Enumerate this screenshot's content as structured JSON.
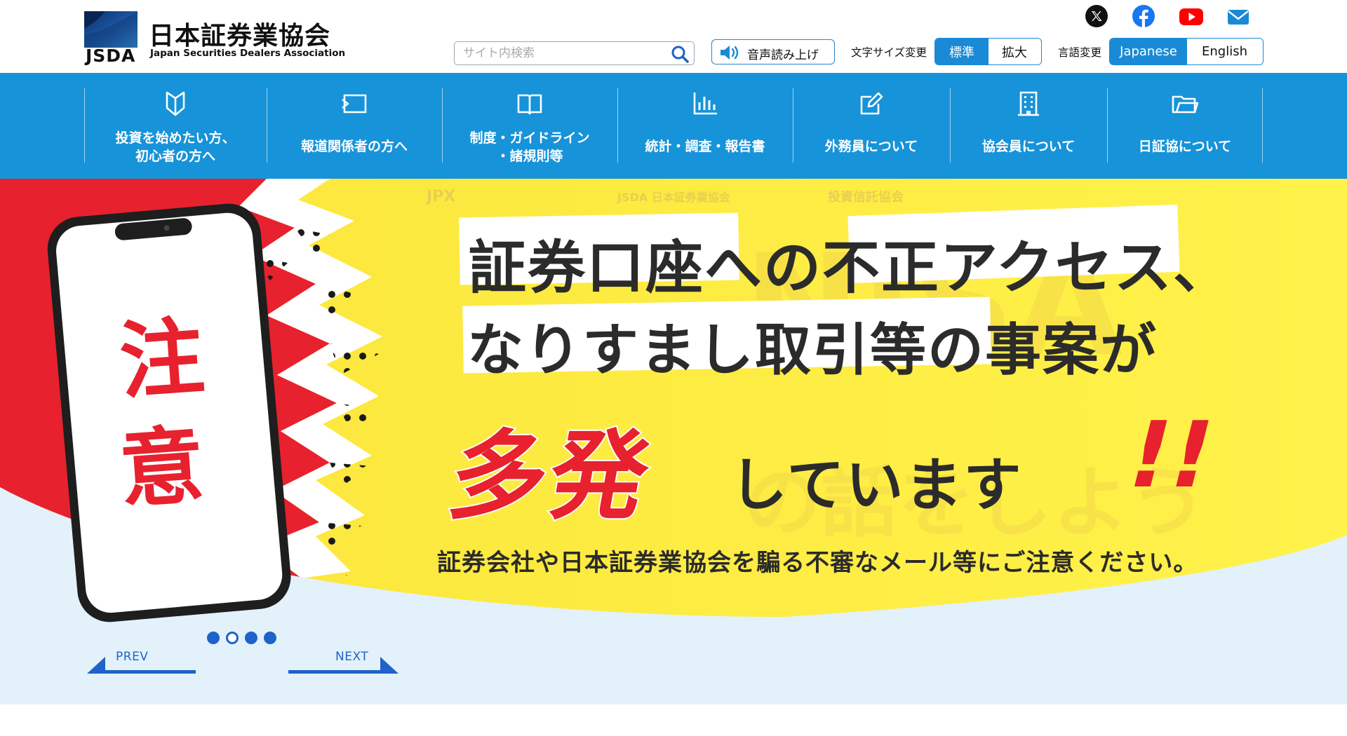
{
  "brand": {
    "abbr": "JSDA",
    "name": "日本証券業協会",
    "subtitle": "Japan Securities Dealers Association",
    "color_dark": "#123a78",
    "color_light": "#3aa3e3"
  },
  "search": {
    "placeholder": "サイト内検索"
  },
  "voice": {
    "label": "音声読み上げ"
  },
  "font_size": {
    "label": "文字サイズ変更",
    "options": [
      "標準",
      "拡大"
    ],
    "selected": "標準"
  },
  "language": {
    "label": "言語変更",
    "options": [
      "Japanese",
      "English"
    ],
    "selected": "Japanese"
  },
  "social": [
    {
      "name": "x-icon"
    },
    {
      "name": "facebook-icon"
    },
    {
      "name": "youtube-icon"
    },
    {
      "name": "mail-icon"
    }
  ],
  "nav": {
    "items": [
      {
        "icon": "beginner-mark-icon",
        "line1": "投資を始めたい方、",
        "line2": "初心者の方へ"
      },
      {
        "icon": "press-icon",
        "line1": "報道関係者の方へ",
        "line2": ""
      },
      {
        "icon": "book-icon",
        "line1": "制度・ガイドライン",
        "line2": "・諸規則等"
      },
      {
        "icon": "bar-chart-icon",
        "line1": "統計・調査・報告書",
        "line2": ""
      },
      {
        "icon": "edit-icon",
        "line1": "外務員について",
        "line2": ""
      },
      {
        "icon": "building-icon",
        "line1": "協会員について",
        "line2": ""
      },
      {
        "icon": "folder-icon",
        "line1": "日証協について",
        "line2": ""
      }
    ]
  },
  "banner": {
    "phone_word": [
      "注",
      "意"
    ],
    "title_line1": "証券口座への不正アクセス、",
    "title_line2": "なりすまし取引等の事案が",
    "title_emph": "多発",
    "title_tail": "しています",
    "title_mark": "!!",
    "subtitle": "証券会社や日本証券業協会を騙る不審なメール等にご注意ください。",
    "slides_count": 4,
    "active_slide": 2,
    "prev_label": "PREV",
    "next_label": "NEXT",
    "accent_red": "#e8212e",
    "accent_yellow": "#fbe53a"
  },
  "colors": {
    "nav_bg": "#1793d9",
    "primary": "#1a8ad6",
    "pager": "#1f62c9"
  }
}
